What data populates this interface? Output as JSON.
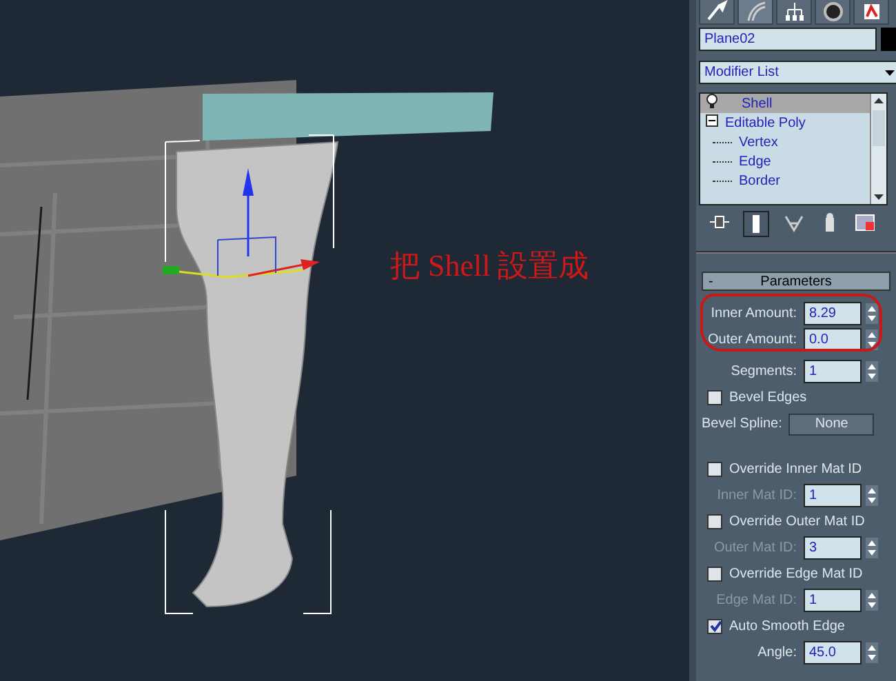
{
  "viewport": {
    "annotation": "把 Shell 設置成"
  },
  "command_panel": {
    "tabs": [
      {
        "kind": "create",
        "selected": false
      },
      {
        "kind": "modify",
        "selected": true
      },
      {
        "kind": "hierarchy",
        "selected": false
      },
      {
        "kind": "motion",
        "selected": false
      },
      {
        "kind": "display",
        "selected": false
      }
    ],
    "object_name": "Plane02",
    "modifier_list": "Modifier List",
    "stack": [
      {
        "label": "Shell",
        "kind": "modifier",
        "selected": true
      },
      {
        "label": "Editable Poly",
        "kind": "object",
        "expanded": true,
        "selected": false,
        "children": [
          {
            "label": "Vertex",
            "selected": false
          },
          {
            "label": "Edge",
            "selected": false
          },
          {
            "label": "Border",
            "selected": false
          }
        ]
      }
    ],
    "rollout": {
      "sign": "-",
      "title": "Parameters",
      "groups": [
        {
          "highlighted": true,
          "rows": [
            {
              "kind": "spinner",
              "label": "Inner Amount:",
              "value": "8.29",
              "disabled": false
            },
            {
              "kind": "spinner",
              "label": "Outer Amount:",
              "value": "0.0",
              "disabled": false
            }
          ]
        },
        {
          "highlighted": false,
          "rows": [
            {
              "kind": "spinner",
              "label": "Segments:",
              "value": "1",
              "disabled": false
            },
            {
              "kind": "checkbox",
              "label": "Bevel Edges",
              "checked": false
            },
            {
              "kind": "button",
              "label": "Bevel Spline:",
              "value": "None"
            }
          ]
        },
        {
          "highlighted": false,
          "rows": [
            {
              "kind": "checkbox",
              "label": "Override Inner Mat ID",
              "checked": false
            },
            {
              "kind": "spinner",
              "label": "Inner Mat ID:",
              "value": "1",
              "disabled": true
            },
            {
              "kind": "checkbox",
              "label": "Override Outer Mat ID",
              "checked": false
            },
            {
              "kind": "spinner",
              "label": "Outer Mat ID:",
              "value": "3",
              "disabled": true
            },
            {
              "kind": "checkbox",
              "label": "Override Edge Mat ID",
              "checked": false
            },
            {
              "kind": "spinner",
              "label": "Edge Mat ID:",
              "value": "1",
              "disabled": true
            },
            {
              "kind": "checkbox",
              "label": "Auto Smooth Edge",
              "checked": true
            },
            {
              "kind": "spinner",
              "label": "Angle:",
              "value": "45.0",
              "disabled": false
            }
          ]
        }
      ]
    }
  }
}
